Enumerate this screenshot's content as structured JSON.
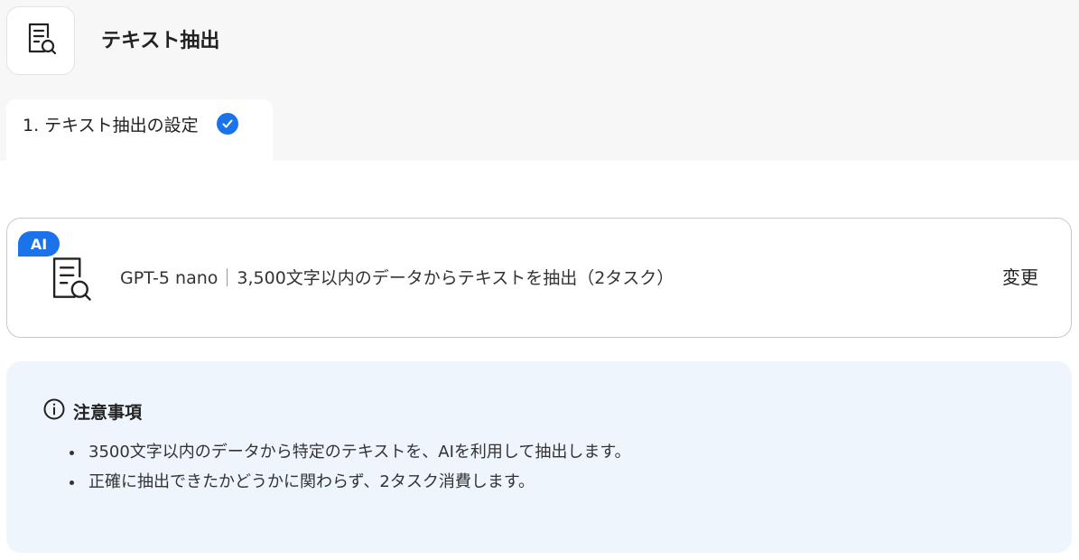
{
  "header": {
    "app_icon": "document-search-icon",
    "title": "テキスト抽出"
  },
  "tabs": [
    {
      "label": "1. テキスト抽出の設定",
      "status_icon": "check-circle-icon",
      "completed": true
    }
  ],
  "model_card": {
    "badge": "AI",
    "icon": "document-search-icon",
    "model_name": "GPT-5 nano",
    "description": "3,500文字以内のデータからテキストを抽出（2タスク）",
    "change_label": "変更"
  },
  "notice": {
    "icon": "info-icon",
    "title": "注意事項",
    "items": [
      "3500文字以内のデータから特定のテキストを、AIを利用して抽出します。",
      "正確に抽出できたかどうかに関わらず、2タスク消費します。"
    ]
  },
  "colors": {
    "accent": "#1a73e8",
    "notice_bg": "#eef5fd",
    "top_band": "#f7f7f7"
  }
}
